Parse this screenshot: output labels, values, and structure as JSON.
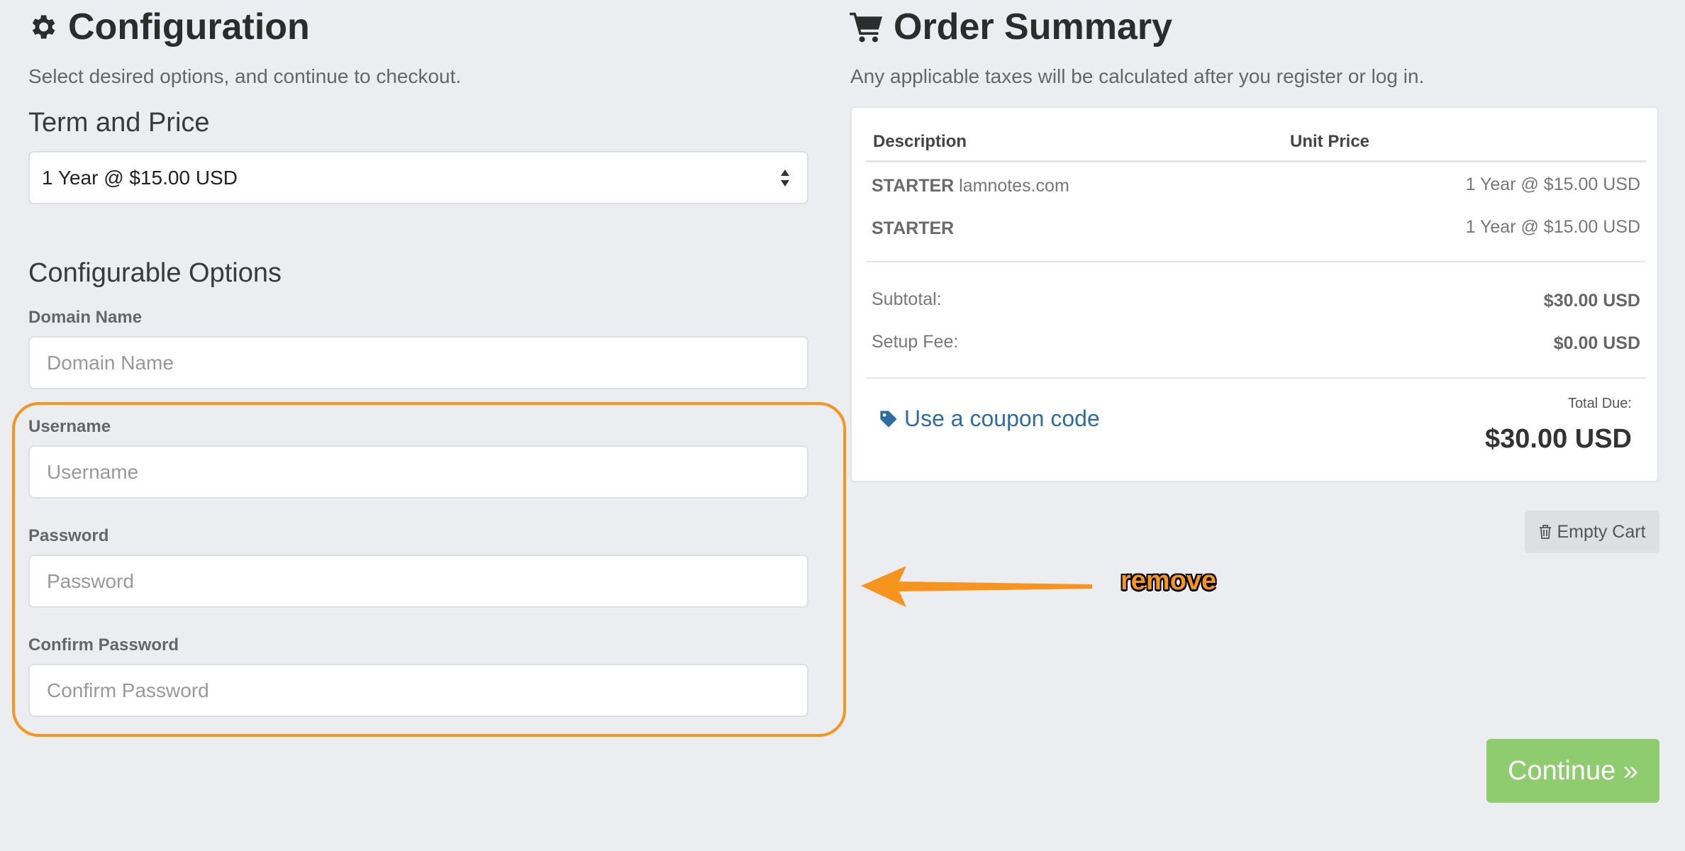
{
  "configuration": {
    "title": "Configuration",
    "subtitle": "Select desired options, and continue to checkout.",
    "term_heading": "Term and Price",
    "term_select_value": "1 Year @ $15.00 USD",
    "options_heading": "Configurable Options",
    "domain": {
      "label": "Domain Name",
      "placeholder": "Domain Name"
    },
    "username": {
      "label": "Username",
      "placeholder": "Username"
    },
    "password": {
      "label": "Password",
      "placeholder": "Password"
    },
    "confirm_password": {
      "label": "Confirm Password",
      "placeholder": "Confirm Password"
    }
  },
  "order_summary": {
    "title": "Order Summary",
    "subtitle": "Any applicable taxes will be calculated after you register or log in.",
    "columns": [
      "Description",
      "Unit Price"
    ],
    "items": [
      {
        "product": "STARTER",
        "detail": "lamnotes.com",
        "price": "1 Year @ $15.00 USD"
      },
      {
        "product": "STARTER",
        "detail": "",
        "price": "1 Year @ $15.00 USD"
      }
    ],
    "subtotal_label": "Subtotal:",
    "subtotal_value": "$30.00 USD",
    "setup_fee_label": "Setup Fee:",
    "setup_fee_value": "$0.00 USD",
    "coupon_label": "Use a coupon code",
    "total_due_label": "Total Due:",
    "total_due_value": "$30.00 USD"
  },
  "buttons": {
    "empty_cart": "Empty Cart",
    "continue": "Continue »"
  },
  "annotation": {
    "text": "remove",
    "color": "#f7941d"
  },
  "colors": {
    "background": "#ebedf0",
    "link": "#2d6da3",
    "continue_button": "#8fcb6f"
  },
  "icons": [
    "gear-icon",
    "cart-icon",
    "tag-icon",
    "trash-icon",
    "select-arrows-icon",
    "arrow-left-icon"
  ]
}
